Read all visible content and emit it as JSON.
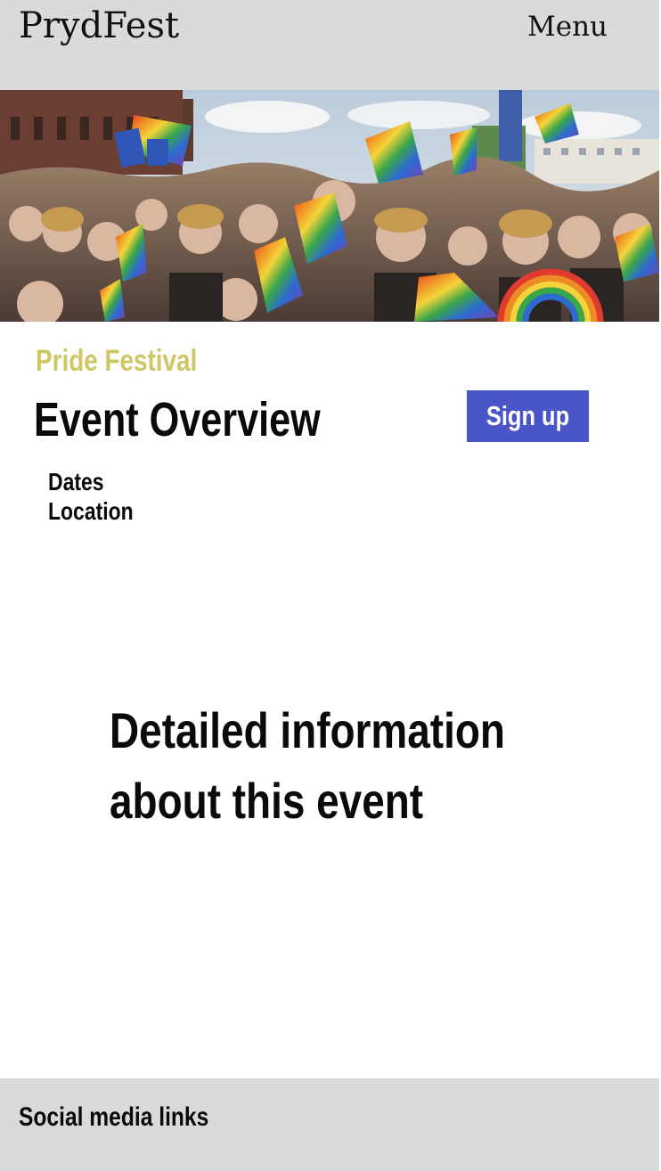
{
  "header": {
    "brand": "PrydFest",
    "menu_label": "Menu"
  },
  "hero": {
    "image_icon": "crowd-photo",
    "colors": {
      "sky": "#c9d6e2",
      "building": "#6b3e34",
      "crowd": "#8c6c5a"
    }
  },
  "event": {
    "category": "Pride Festival",
    "title": "Event Overview",
    "signup_label": "Sign up",
    "facts": [
      "Dates",
      "Location"
    ],
    "detail_lines": [
      "Detailed information",
      "about this event"
    ]
  },
  "footer": {
    "text": "Social media links"
  },
  "colors": {
    "header_bg": "#dadada",
    "accent": "#cfc765",
    "button": "#4a55c8"
  }
}
